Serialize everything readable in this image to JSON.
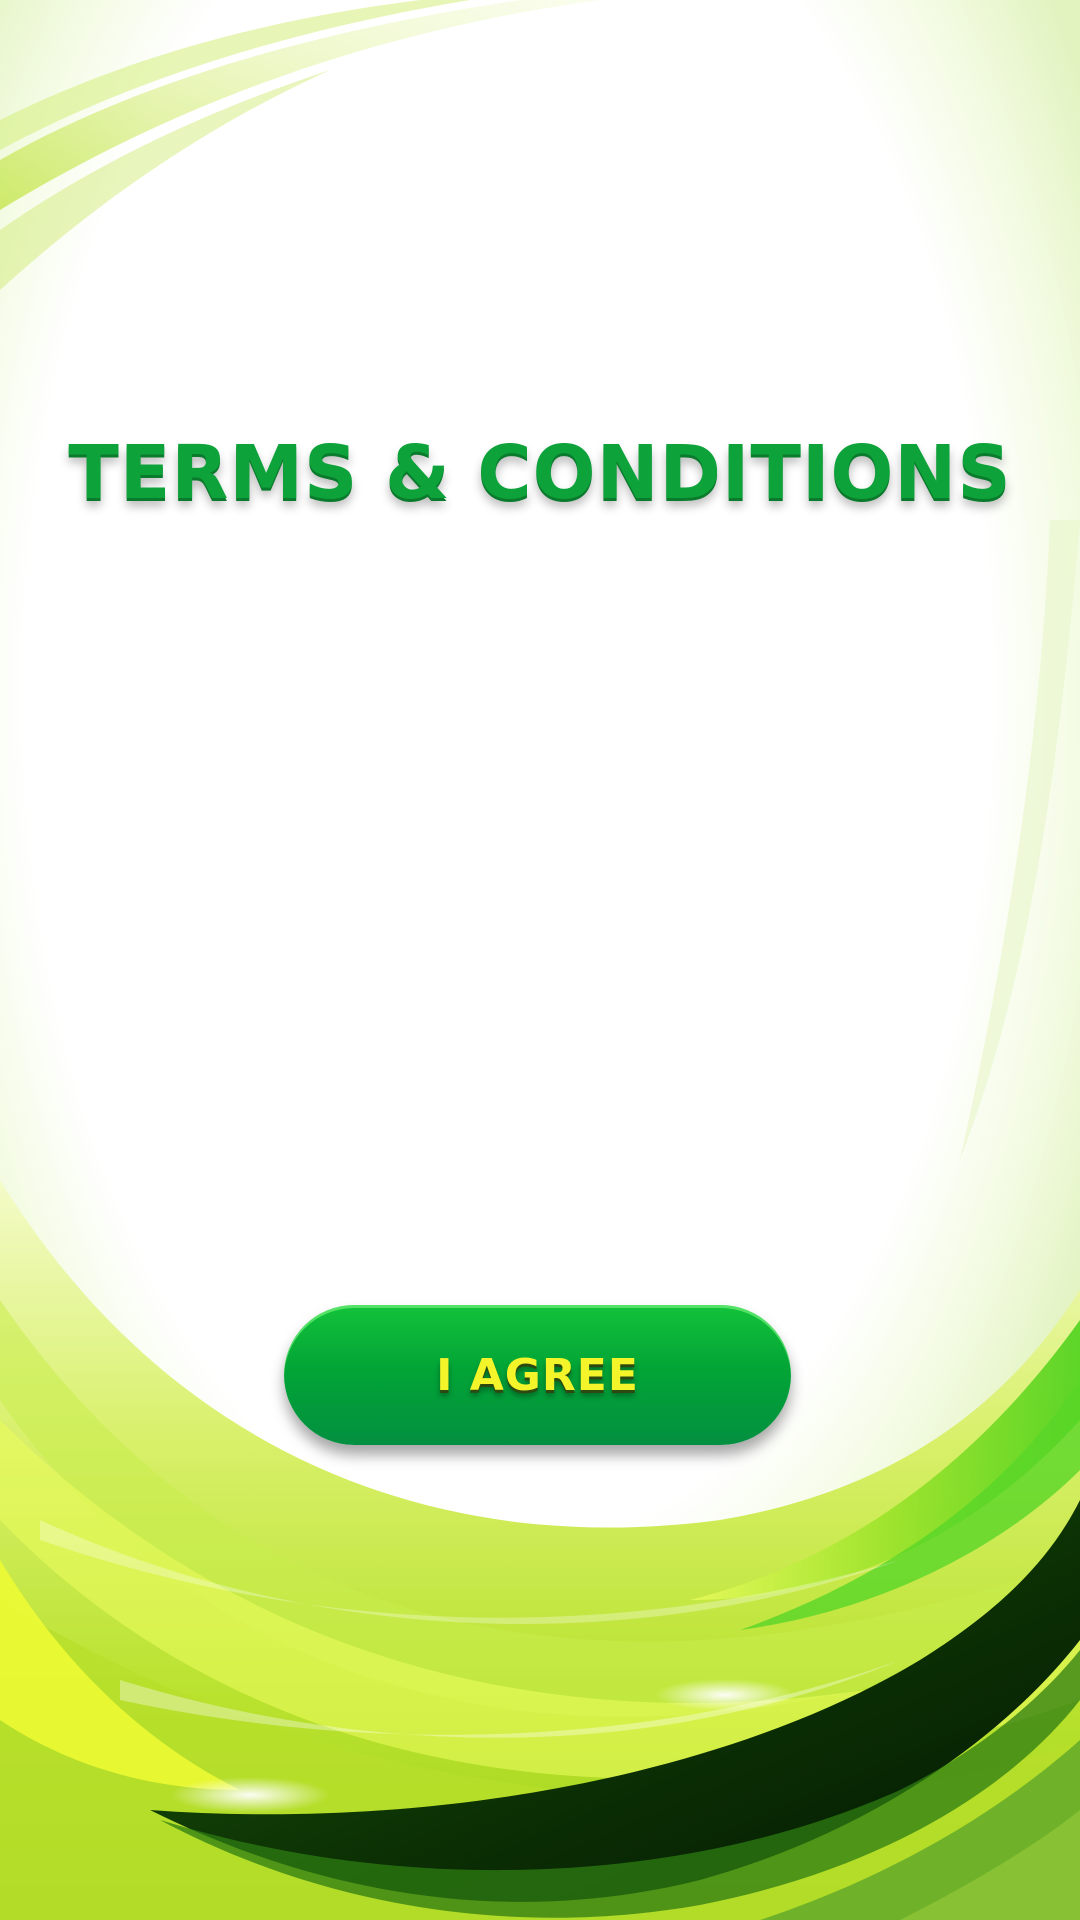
{
  "screen": {
    "title": "TERMS & CONDITIONS",
    "agree_button_label": "I AGREE"
  },
  "colors": {
    "title": "#0ea23a",
    "button": "#02a536",
    "button_text": "#f4f42a",
    "background_accent": "#7ccc1a"
  }
}
